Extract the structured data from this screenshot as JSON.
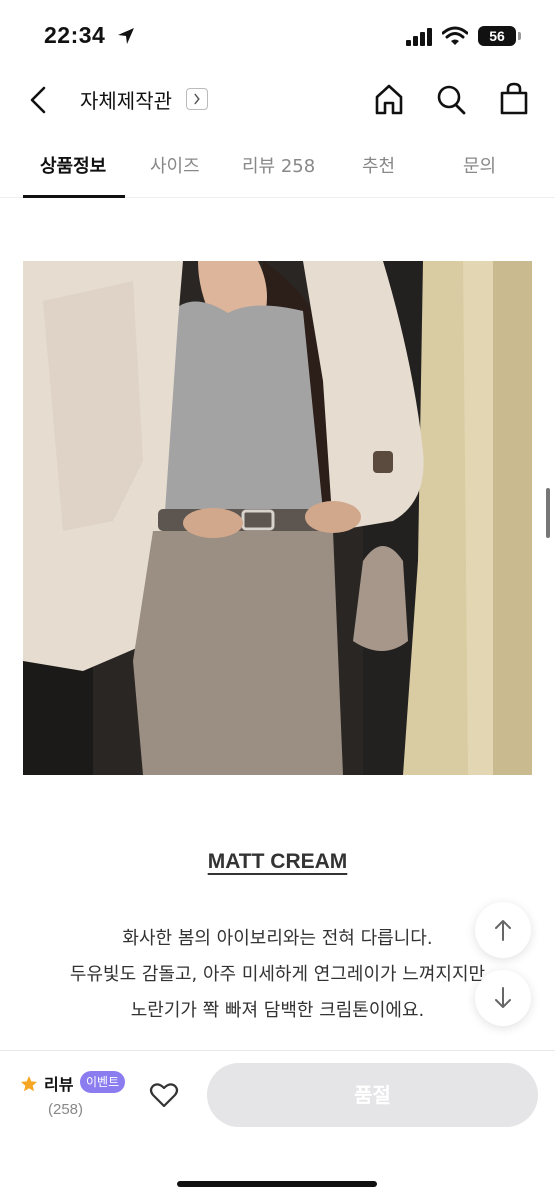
{
  "status_bar": {
    "time": "22:34",
    "battery": "56"
  },
  "header": {
    "title": "자체제작관"
  },
  "tabs": [
    {
      "label": "상품정보",
      "active": true
    },
    {
      "label": "사이즈",
      "active": false
    },
    {
      "label": "리뷰 258",
      "active": false
    },
    {
      "label": "추천",
      "active": false
    },
    {
      "label": "문의",
      "active": false
    }
  ],
  "product": {
    "name": "MATT CREAM",
    "description": [
      "화사한 봄의 아이보리와는 전혀 다릅니다.",
      "두유빛도 감돌고, 아주 미세하게 연그레이가 느껴지지만",
      "노란기가 쫙 빠져 담백한 크림톤이에요."
    ]
  },
  "bottom_bar": {
    "review_label": "리뷰",
    "event_badge": "이벤트",
    "review_count": "(258)",
    "soldout_label": "품절"
  },
  "colors": {
    "accent": "#111111",
    "badge": "#8b7cf0",
    "star": "#f5a623",
    "disabled_button": "#e5e5e7"
  }
}
